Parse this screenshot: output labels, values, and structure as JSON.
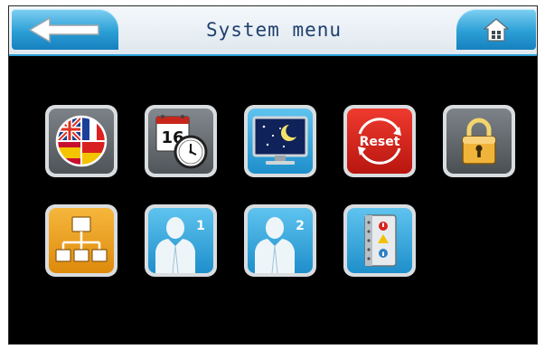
{
  "header": {
    "title": "System menu",
    "back_icon": "back-arrow-icon",
    "home_icon": "home-icon"
  },
  "menu": {
    "row1": [
      {
        "name": "language",
        "icon": "flags-globe-icon"
      },
      {
        "name": "date-time",
        "icon": "calendar-clock-icon",
        "calendar_day": "16"
      },
      {
        "name": "screensaver",
        "icon": "night-monitor-icon"
      },
      {
        "name": "reset",
        "icon": "reset-icon",
        "label": "Reset"
      },
      {
        "name": "lock",
        "icon": "padlock-icon"
      }
    ],
    "row2": [
      {
        "name": "network",
        "icon": "network-tree-icon"
      },
      {
        "name": "user-1",
        "icon": "user-icon",
        "badge": "1"
      },
      {
        "name": "user-2",
        "icon": "user-icon",
        "badge": "2"
      },
      {
        "name": "event-log",
        "icon": "alert-notebook-icon"
      }
    ]
  },
  "colors": {
    "header_accent": "#2aa0d8",
    "title_text": "#1f3f6e",
    "tile_blue": "#2ea7de",
    "tile_red": "#d9231d",
    "tile_orange": "#f0a11a",
    "tile_grey": "#6a6f73"
  }
}
